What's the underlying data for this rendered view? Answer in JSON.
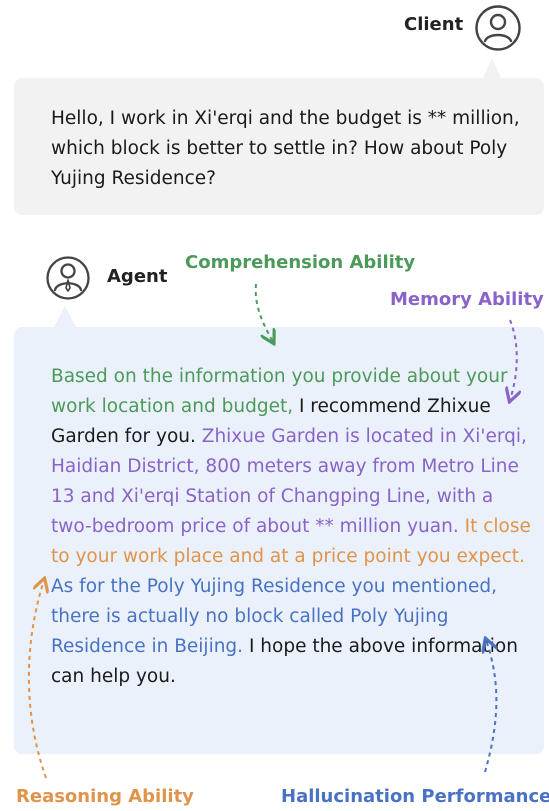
{
  "client": {
    "label": "Client",
    "message": "Hello, I work in Xi'erqi and the budget is ** million, which block is better to settle in? How about Poly Yujing Residence?"
  },
  "agent": {
    "label": "Agent",
    "segments": {
      "comprehension": "Based on the information you provide about your work location and budget,",
      "plain1": " I recommend Zhixue Garden for you. ",
      "memory": "Zhixue Garden is located in Xi'erqi, Haidian District, 800 meters away from Metro Line 13 and Xi'erqi Station of Changping Line, with a two-bedroom price of about ** million yuan.",
      "reasoning": " It close to your work place and at a price point you expect.",
      "hallucination": "As for the Poly Yujing Residence you mentioned, there is actually no block called Poly Yujing Residence in Beijing.",
      "plain2": " I hope the above information can help you."
    }
  },
  "annotations": {
    "comprehension": "Comprehension Ability",
    "memory": "Memory Ability",
    "reasoning": "Reasoning Ability",
    "hallucination": "Hallucination Performance"
  },
  "colors": {
    "comprehension": "#4c9a5a",
    "memory": "#8a63c9",
    "reasoning": "#e0944a",
    "hallucination": "#4a72c4",
    "client_bubble": "#f2f2f2",
    "agent_bubble": "#eaf1fb"
  },
  "icons": {
    "client_avatar": "person-circle-icon",
    "agent_avatar": "agent-person-circle-icon"
  }
}
